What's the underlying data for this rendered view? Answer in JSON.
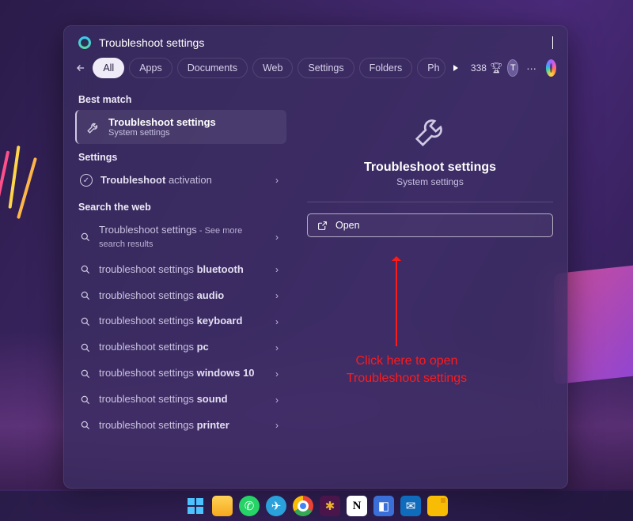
{
  "search": {
    "query": "Troubleshoot settings"
  },
  "tabs": {
    "all": "All",
    "apps": "Apps",
    "documents": "Documents",
    "web": "Web",
    "settings": "Settings",
    "folders": "Folders",
    "photos_cut": "Ph"
  },
  "header": {
    "points": "338",
    "avatar_initial": "T"
  },
  "left": {
    "best_match_h": "Best match",
    "best_title": "Troubleshoot settings",
    "best_sub": "System settings",
    "settings_h": "Settings",
    "settings_item_prefix": "Troubleshoot",
    "settings_item_suffix": " activation",
    "web_h": "Search the web",
    "web_items": [
      {
        "prefix": "Troubleshoot settings",
        "suffix": "",
        "extra": " - See more search results"
      },
      {
        "prefix": "troubleshoot settings ",
        "suffix": "bluetooth",
        "extra": ""
      },
      {
        "prefix": "troubleshoot settings ",
        "suffix": "audio",
        "extra": ""
      },
      {
        "prefix": "troubleshoot settings ",
        "suffix": "keyboard",
        "extra": ""
      },
      {
        "prefix": "troubleshoot settings ",
        "suffix": "pc",
        "extra": ""
      },
      {
        "prefix": "troubleshoot settings ",
        "suffix": "windows 10",
        "extra": ""
      },
      {
        "prefix": "troubleshoot settings ",
        "suffix": "sound",
        "extra": ""
      },
      {
        "prefix": "troubleshoot settings ",
        "suffix": "printer",
        "extra": ""
      }
    ]
  },
  "right": {
    "title": "Troubleshoot settings",
    "sub": "System settings",
    "open_label": "Open"
  },
  "annotation": {
    "text": "Click here to open Troubleshoot settings"
  },
  "taskbar": {
    "notion_letter": "N"
  }
}
